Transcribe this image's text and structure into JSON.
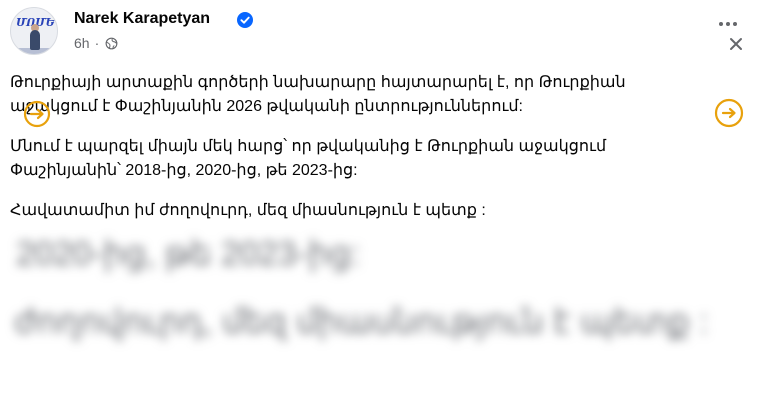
{
  "post": {
    "author": "Narek Karapetyan",
    "time": "6h",
    "dot": "·",
    "paragraphs": [
      "Թուրքիայի արտաքին գործերի նախարարը հայտարարել է, որ Թուրքիան աջակցում է Փաշինյանին 2026 թվականի ընտրություններում:",
      "Մնում է պարզել միայն մեկ հարց՝ որ թվականից է Թուրքիան աջակցում Փաշինյանին՝ 2018-ից, 2020-ից, թե 2023-ից:",
      "Հավատամիտ իմ ժողովուրդ, մեզ միասնություն է պետք :"
    ],
    "blurred_lines": [
      "2020-ից, թե 2023-ից:",
      "ժողովուրդ, մեզ միասնություն է պետք :"
    ]
  },
  "icons": {
    "verified": "verified-badge-icon",
    "globe": "globe-icon",
    "more": "more-options-icon",
    "close": "close-icon",
    "translate": "arrow-circle-right-icon"
  },
  "colors": {
    "verified": "#0866ff",
    "translate_accent": "#e8a10c",
    "meta_text": "#65676b"
  }
}
